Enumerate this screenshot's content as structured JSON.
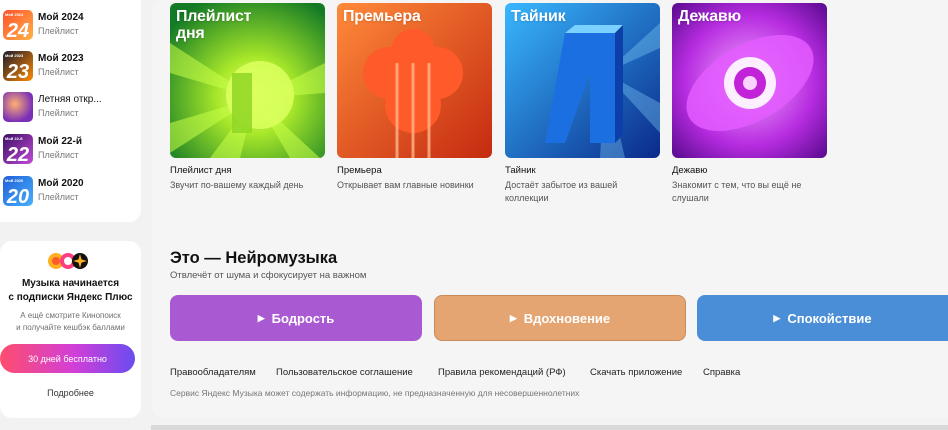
{
  "sidebar": {
    "playlists": [
      {
        "title": "Мой 2024",
        "subtitle": "Плейлист",
        "cover_text": "24",
        "cover_small": "Мой 2024",
        "color_a": "#ff6a2b",
        "color_b": "#ffb347"
      },
      {
        "title": "Мой 2023",
        "subtitle": "Плейлист",
        "cover_text": "23",
        "cover_small": "Мой 2023",
        "color_a": "#1a1a2e",
        "color_b": "#ff8a00"
      },
      {
        "title": "Летняя откр...",
        "subtitle": "Плейлист",
        "cover_text": "",
        "cover_small": "",
        "color_a": "#7a2fb8",
        "color_b": "#ff7a59"
      },
      {
        "title": "Мой 22-й",
        "subtitle": "Плейлист",
        "cover_text": "22",
        "cover_small": "Мой 22-й",
        "color_a": "#5b1f8a",
        "color_b": "#c14bd6"
      },
      {
        "title": "Мой 2020",
        "subtitle": "Плейлист",
        "cover_text": "20",
        "cover_small": "Мой 2020",
        "color_a": "#1f5fd6",
        "color_b": "#47b0ff"
      }
    ],
    "promo": {
      "title_line1": "Музыка начинается",
      "title_line2": "с подписки Яндекс Плюс",
      "desc_line1": "А ещё смотрите Кинопоиск",
      "desc_line2": "и получайте кешбэк баллами",
      "button": "30 дней бесплатно",
      "more": "Подробнее"
    }
  },
  "cards": [
    {
      "cover_label_line1": "Плейлист",
      "cover_label_line2": "дня",
      "title": "Плейлист дня",
      "desc": "Звучит по-вашему каждый день",
      "color_a": "#b6f21f",
      "color_b": "#1e8a2a"
    },
    {
      "cover_label_line1": "Премьера",
      "cover_label_line2": "",
      "title": "Премьера",
      "desc": "Открывает вам главные новинки",
      "color_a": "#ff7a2e",
      "color_b": "#c7300f"
    },
    {
      "cover_label_line1": "Тайник",
      "cover_label_line2": "",
      "title": "Тайник",
      "desc": "Достаёт забытое из вашей коллекции",
      "color_a": "#2aa8ff",
      "color_b": "#0a2f8f"
    },
    {
      "cover_label_line1": "Дежавю",
      "cover_label_line2": "",
      "title": "Дежавю",
      "desc": "Знакомит с тем, что вы ещё не слушали",
      "color_a": "#e96bff",
      "color_b": "#7b12b5"
    }
  ],
  "vibe_section": {
    "title": "Это — Нейромузыка",
    "subtitle": "Отвлечёт от шума и сфокусирует на важном",
    "buttons": [
      {
        "label": "Бодрость",
        "color": "#a95ad3"
      },
      {
        "label": "Вдохновение",
        "color": "#e5a572"
      },
      {
        "label": "Спокойствие",
        "color": "#4a8ed8"
      }
    ]
  },
  "footer": {
    "links": [
      "Правообладателям",
      "Пользовательское соглашение",
      "Правила рекомендаций (РФ)",
      "Скачать приложение",
      "Справка"
    ],
    "note": "Сервис Яндекс Музыка может содержать информацию, не предназначенную для несовершеннолетних"
  }
}
